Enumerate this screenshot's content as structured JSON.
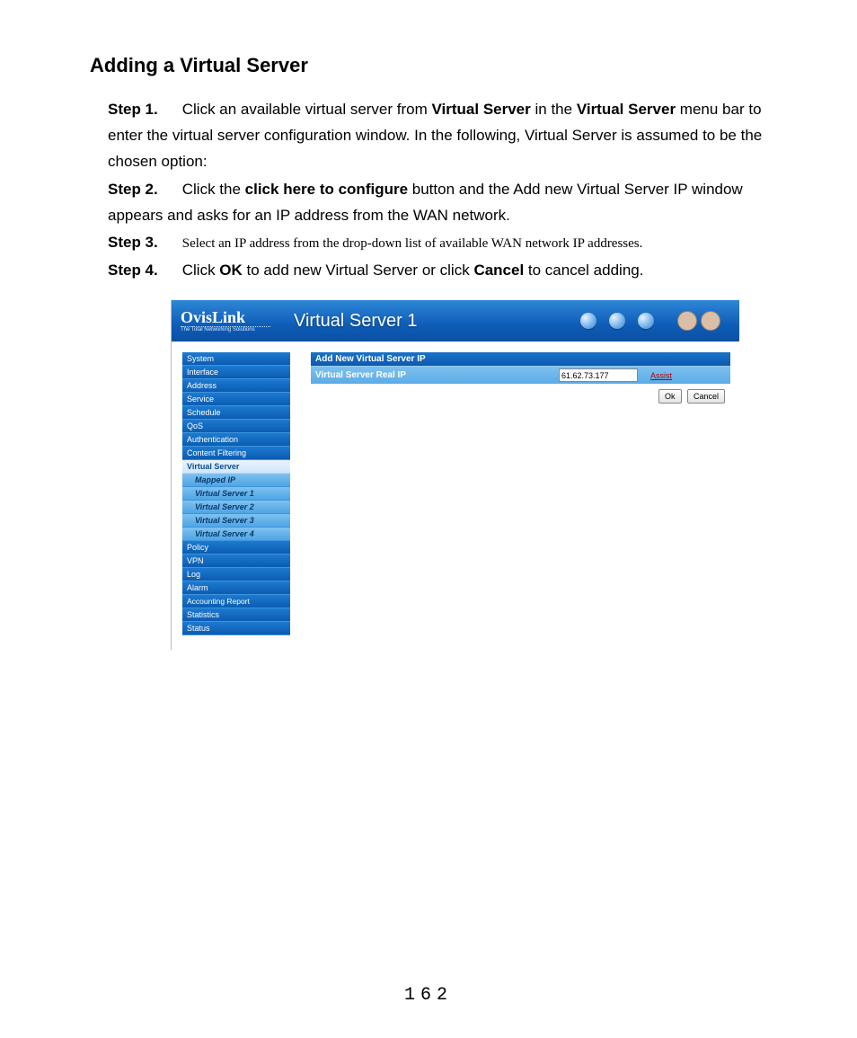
{
  "doc": {
    "heading": "Adding a Virtual Server",
    "step1_label": "Step 1.",
    "step1_a": "Click an available virtual server from ",
    "step1_b": "Virtual Server",
    "step1_c": " in the ",
    "step1_d": "Virtual Server",
    "step1_e": " menu bar to enter the virtual server configuration window.    In the following, Virtual Server is assumed to be the chosen option:",
    "step2_label": "Step 2.",
    "step2_a": "Click the ",
    "step2_b": "click here to configure",
    "step2_c": " button and the Add new Virtual Server IP window appears and asks for an IP address from the WAN network.",
    "step3_label": "Step 3.",
    "step3_a": "Select an IP address from the drop-down list of available WAN network IP addresses.",
    "step4_label": "Step 4.",
    "step4_a": "Click ",
    "step4_b": "OK",
    "step4_c": " to add new Virtual Server or click ",
    "step4_d": "Cancel",
    "step4_e": " to cancel adding.",
    "page_number": "162"
  },
  "shot": {
    "brand": "OvisLink",
    "brand_tag": "The Total Networking Solutions",
    "page_title": "Virtual Server 1",
    "sidebar": {
      "items": [
        "System",
        "Interface",
        "Address",
        "Service",
        "Schedule",
        "QoS",
        "Authentication",
        "Content Filtering",
        "Virtual Server",
        "Mapped IP",
        "Virtual Server 1",
        "Virtual Server 2",
        "Virtual Server 3",
        "Virtual Server 4",
        "Policy",
        "VPN",
        "Log",
        "Alarm",
        "Accounting Report",
        "Statistics",
        "Status"
      ]
    },
    "form": {
      "header": "Add New Virtual Server IP",
      "row_label": "Virtual Server Real IP",
      "ip_value": "61.62.73.177",
      "assist": "Assist",
      "ok": "Ok",
      "cancel": "Cancel"
    }
  }
}
